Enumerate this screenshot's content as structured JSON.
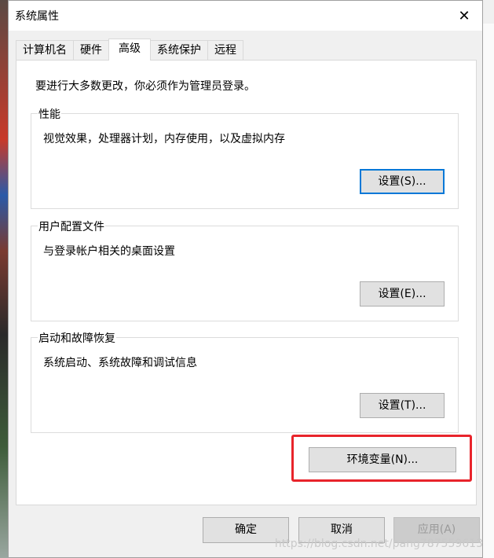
{
  "window": {
    "title": "系统属性"
  },
  "tabs": [
    {
      "label": "计算机名"
    },
    {
      "label": "硬件"
    },
    {
      "label": "高级"
    },
    {
      "label": "系统保护"
    },
    {
      "label": "远程"
    }
  ],
  "panel": {
    "notice": "要进行大多数更改，你必须作为管理员登录。",
    "performance": {
      "legend": "性能",
      "description": "视觉效果，处理器计划，内存使用，以及虚拟内存",
      "button": "设置(S)..."
    },
    "user_profiles": {
      "legend": "用户配置文件",
      "description": "与登录帐户相关的桌面设置",
      "button": "设置(E)..."
    },
    "startup_recovery": {
      "legend": "启动和故障恢复",
      "description": "系统启动、系统故障和调试信息",
      "button": "设置(T)..."
    },
    "env_button": "环境变量(N)..."
  },
  "footer": {
    "ok": "确定",
    "cancel": "取消",
    "apply": "应用(A)"
  },
  "watermark": "https://blog.csdn.net/pang787559613",
  "colors": {
    "highlight": "#e8242b",
    "focus": "#0078d7"
  }
}
